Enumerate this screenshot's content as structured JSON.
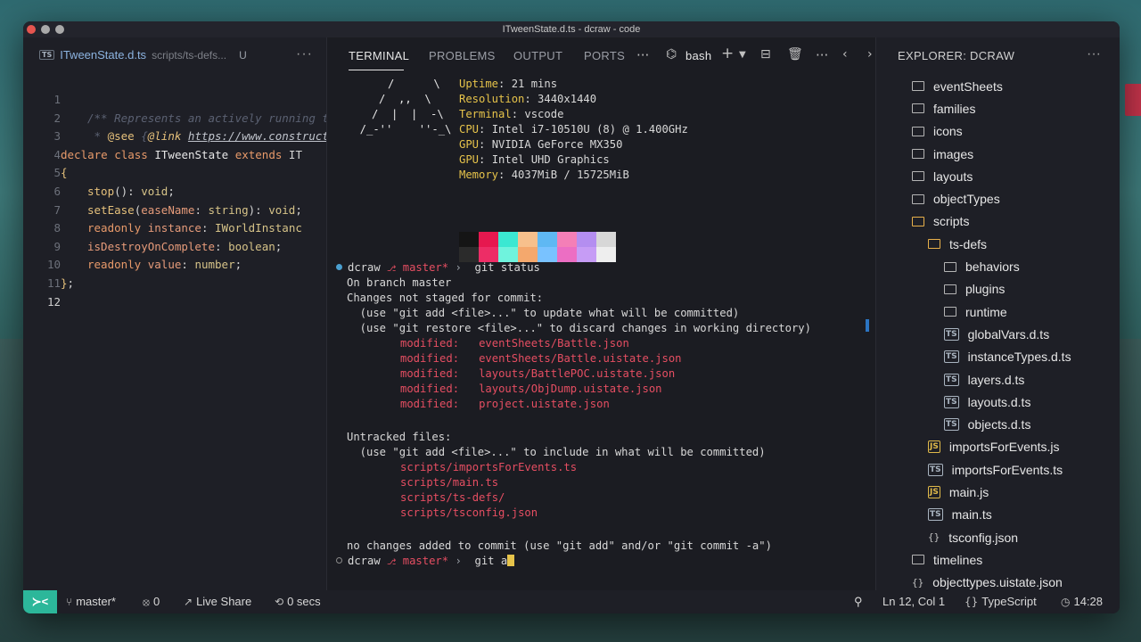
{
  "window": {
    "title": "ITweenState.d.ts - dcraw - code"
  },
  "editor": {
    "tab": {
      "badge": "TS",
      "name": "ITweenState.d.ts",
      "path": "scripts/ts-defs...",
      "status": "U"
    },
    "more": "···",
    "line_numbers": [
      "1",
      "2",
      "3",
      "4",
      "5",
      "6",
      "7",
      "8",
      "9",
      "10",
      "11",
      "12"
    ]
  },
  "terminal": {
    "tabs": {
      "terminal": "TERMINAL",
      "problems": "PROBLEMS",
      "output": "OUTPUT",
      "ports": "PORTS",
      "more": "···",
      "shell": "bash"
    },
    "sysinfo": {
      "uptime_key": "Uptime",
      "uptime": ": 21 mins",
      "resolution_key": "Resolution",
      "resolution": ": 3440x1440",
      "terminal_key": "Terminal",
      "terminal": ": vscode",
      "cpu_key": "CPU",
      "cpu": ": Intel i7-10510U (8) @ 1.400GHz",
      "gpu1_key": "GPU",
      "gpu1": ": NVIDIA GeForce MX350",
      "gpu2_key": "GPU",
      "gpu2": ": Intel UHD Graphics",
      "memory_key": "Memory",
      "memory": ": 4037MiB / 15725MiB"
    },
    "swatches": [
      "#151515",
      "#2b2b2b",
      "#e6184f",
      "#ed2d66",
      "#3be8d2",
      "#6ff3dd",
      "#f7c08c",
      "#f4a86d",
      "#5fb8f3",
      "#79c2ff",
      "#f47fb7",
      "#ec6ec3",
      "#b48ef0",
      "#c69cf5",
      "#d7d7d7",
      "#eeeeee"
    ],
    "prompt1": {
      "dir": "dcraw",
      "branch": "master*",
      "cmd": "git status"
    },
    "lines": {
      "on_branch": "On branch master",
      "changes": "Changes not staged for commit:",
      "hint1": "  (use \"git add <file>...\" to update what will be committed)",
      "hint2": "  (use \"git restore <file>...\" to discard changes in working directory)",
      "untracked": "Untracked files:",
      "hint3": "  (use \"git add <file>...\" to include in what will be committed)",
      "no_changes": "no changes added to commit (use \"git add\" and/or \"git commit -a\")"
    },
    "modified": [
      {
        "label": "modified:",
        "file": "eventSheets/Battle.json"
      },
      {
        "label": "modified:",
        "file": "eventSheets/Battle.uistate.json"
      },
      {
        "label": "modified:",
        "file": "layouts/BattlePOC.uistate.json"
      },
      {
        "label": "modified:",
        "file": "layouts/ObjDump.uistate.json"
      },
      {
        "label": "modified:",
        "file": "project.uistate.json"
      }
    ],
    "untracked_files": [
      "scripts/importsForEvents.ts",
      "scripts/main.ts",
      "scripts/ts-defs/",
      "scripts/tsconfig.json"
    ],
    "prompt2": {
      "dir": "dcraw",
      "branch": "master*",
      "cmd": "git a"
    }
  },
  "explorer": {
    "title": "EXPLORER: DCRAW",
    "more": "···",
    "items": [
      {
        "name": "eventSheets",
        "kind": "folder"
      },
      {
        "name": "families",
        "kind": "folder"
      },
      {
        "name": "icons",
        "kind": "folder"
      },
      {
        "name": "images",
        "kind": "folder"
      },
      {
        "name": "layouts",
        "kind": "folder"
      },
      {
        "name": "objectTypes",
        "kind": "folder"
      },
      {
        "name": "scripts",
        "kind": "folder-open"
      },
      {
        "name": "ts-defs",
        "kind": "folder-open"
      },
      {
        "name": "behaviors",
        "kind": "folder"
      },
      {
        "name": "plugins",
        "kind": "folder"
      },
      {
        "name": "runtime",
        "kind": "folder"
      },
      {
        "name": "globalVars.d.ts",
        "kind": "ts"
      },
      {
        "name": "instanceTypes.d.ts",
        "kind": "ts"
      },
      {
        "name": "layers.d.ts",
        "kind": "ts"
      },
      {
        "name": "layouts.d.ts",
        "kind": "ts"
      },
      {
        "name": "objects.d.ts",
        "kind": "ts"
      },
      {
        "name": "importsForEvents.js",
        "kind": "js"
      },
      {
        "name": "importsForEvents.ts",
        "kind": "ts"
      },
      {
        "name": "main.js",
        "kind": "js"
      },
      {
        "name": "main.ts",
        "kind": "ts"
      },
      {
        "name": "tsconfig.json",
        "kind": "json"
      },
      {
        "name": "timelines",
        "kind": "folder"
      },
      {
        "name": "objecttypes.uistate.json",
        "kind": "json"
      }
    ]
  },
  "statusbar": {
    "branch": "master*",
    "ports": "0",
    "liveshare": "Live Share",
    "time": "0 secs",
    "position": "Ln 12, Col 1",
    "language": "TypeScript",
    "clock": "14:28"
  }
}
